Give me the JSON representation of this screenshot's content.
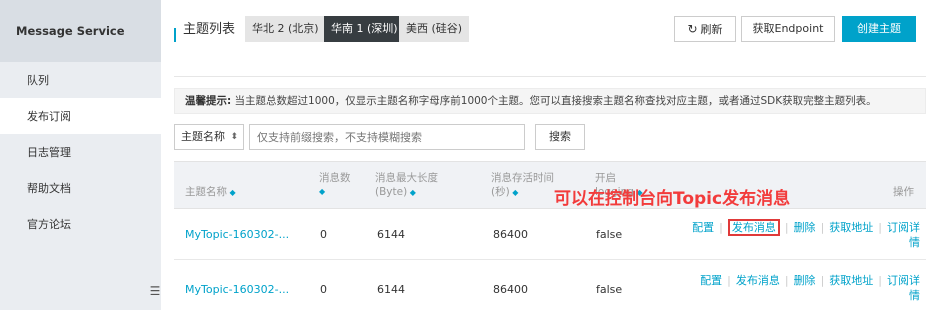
{
  "sidebar": {
    "title": "Message Service",
    "items": [
      {
        "label": "队列",
        "active": false
      },
      {
        "label": "发布订阅",
        "active": true
      },
      {
        "label": "日志管理",
        "active": false
      },
      {
        "label": "帮助文档",
        "active": false
      },
      {
        "label": "官方论坛",
        "active": false
      }
    ],
    "toggle_icon": "list-toggle-icon"
  },
  "header": {
    "title": "主题列表",
    "regions": [
      {
        "label": "华北 2 (北京)",
        "active": false
      },
      {
        "label": "华南 1 (深圳)",
        "active": true
      },
      {
        "label": "美西 (硅谷)",
        "active": false
      }
    ],
    "refresh_icon": "refresh-icon",
    "refresh_label": "刷新",
    "endpoint_label": "获取Endpoint",
    "create_label": "创建主题"
  },
  "notice": {
    "label": "温馨提示:",
    "text": "当主题总数超过1000，仅显示主题名称字母序前1000个主题。您可以直接搜索主题名称查找对应主题，或者通过SDK获取完整主题列表。"
  },
  "filter": {
    "select_value": "主题名称",
    "search_placeholder": "仅支持前缀搜索，不支持模糊搜索",
    "search_value": "",
    "search_button": "搜索"
  },
  "table": {
    "columns": {
      "name": "主题名称",
      "count": "消息数",
      "max_len_1": "消息最大长度",
      "max_len_2": "(Byte)",
      "ttl_1": "消息存活时间",
      "ttl_2": "(秒)",
      "logging_1": "开启",
      "logging_2": "logging",
      "ops": "操作"
    },
    "rows": [
      {
        "name": "MyTopic-160302-...",
        "count": "0",
        "max_len": "6144",
        "ttl": "86400",
        "logging": "false"
      },
      {
        "name": "MyTopic-160302-...",
        "count": "0",
        "max_len": "6144",
        "ttl": "86400",
        "logging": "false"
      }
    ],
    "ops": {
      "config": "配置",
      "publish": "发布消息",
      "delete": "删除",
      "get_address": "获取地址",
      "sub_details_1": "订阅详",
      "sub_details_2": "情"
    }
  },
  "annotation": {
    "text": "可以在控制台向Topic发布消息",
    "color": "#f23b3b"
  },
  "colors": {
    "accent": "#00a2ca",
    "region_active_bg": "#373d41",
    "sidebar_bg": "#eaedf1"
  }
}
